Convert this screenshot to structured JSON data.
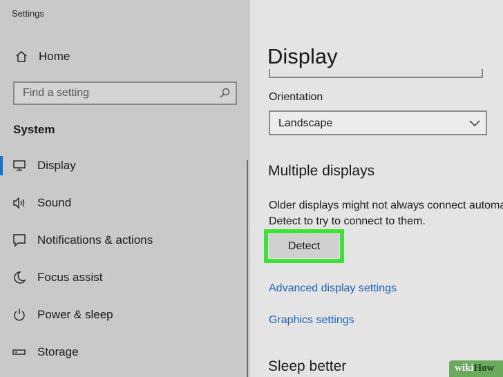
{
  "window": {
    "title": "Settings"
  },
  "sidebar": {
    "home_label": "Home",
    "search_placeholder": "Find a setting",
    "section_title": "System",
    "items": [
      {
        "label": "Display",
        "icon": "monitor-icon",
        "active": true
      },
      {
        "label": "Sound",
        "icon": "speaker-icon"
      },
      {
        "label": "Notifications & actions",
        "icon": "notification-icon"
      },
      {
        "label": "Focus assist",
        "icon": "moon-icon"
      },
      {
        "label": "Power & sleep",
        "icon": "power-icon"
      },
      {
        "label": "Storage",
        "icon": "storage-icon"
      }
    ]
  },
  "main": {
    "title": "Display",
    "orientation_label": "Orientation",
    "orientation_value": "Landscape",
    "multiple_displays_heading": "Multiple displays",
    "description": "Older displays might not always connect automatically. Select\nDetect to try to connect to them.",
    "detect_label": "Detect",
    "advanced_link": "Advanced display settings",
    "graphics_link": "Graphics settings",
    "sleep_heading": "Sleep better"
  },
  "watermark": {
    "prefix": "wiki",
    "suffix": "How"
  },
  "colors": {
    "accent": "#1a6fc7",
    "link": "#1f63b5",
    "highlight": "#3fe038"
  }
}
